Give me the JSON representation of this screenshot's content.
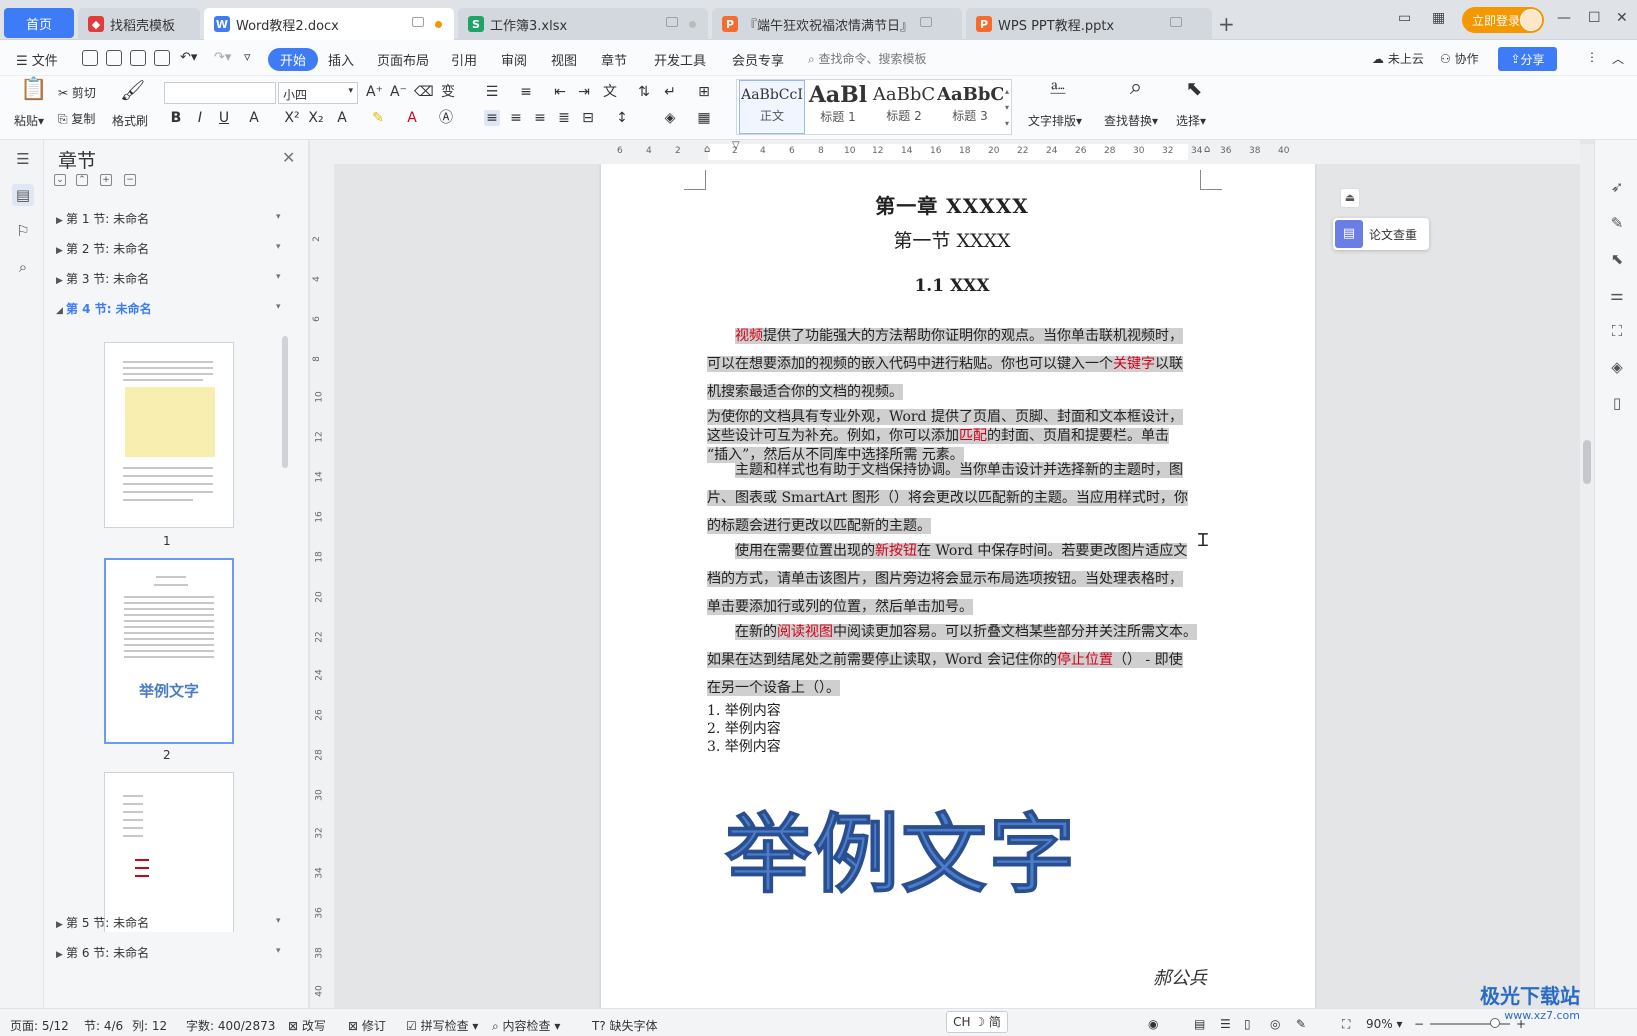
{
  "tabs": {
    "home": "首页",
    "items": [
      {
        "label": "找稻壳模板",
        "icon": "docer-icon",
        "color": "#e23b3b"
      },
      {
        "label": "Word教程2.docx",
        "icon": "word-icon",
        "color": "#3e7bf6"
      },
      {
        "label": "工作簿3.xlsx",
        "icon": "excel-icon",
        "color": "#21a366"
      },
      {
        "label": "『端午狂欢祝福浓情满节日』",
        "icon": "ppt-icon",
        "color": "#f56c2e"
      },
      {
        "label": "WPS PPT教程.pptx",
        "icon": "ppt-icon",
        "color": "#f56c2e"
      }
    ],
    "new_tab": "+",
    "login": "立即登录"
  },
  "menu": {
    "file": "文件",
    "items": [
      "开始",
      "插入",
      "页面布局",
      "引用",
      "审阅",
      "视图",
      "章节",
      "开发工具",
      "会员专享"
    ],
    "active": "开始",
    "search_placeholder": "查找命令、搜索模板",
    "cloud": "未上云",
    "collab": "协作",
    "share": "分享"
  },
  "ribbon": {
    "paste": "粘贴",
    "cut": "剪切",
    "copy": "复制",
    "format_painter": "格式刷",
    "font_size": "小四",
    "styles": [
      {
        "preview": "AaBbCcI",
        "label": "正文"
      },
      {
        "preview": "AaBl",
        "label": "标题 1"
      },
      {
        "preview": "AaBbC",
        "label": "标题 2"
      },
      {
        "preview": "AaBbC",
        "label": "标题 3"
      }
    ],
    "text_layout": "文字排版",
    "find_replace": "查找替换",
    "select": "选择"
  },
  "nav": {
    "title": "章节",
    "sections": [
      {
        "label": "第 1 节: 未命名"
      },
      {
        "label": "第 2 节: 未命名"
      },
      {
        "label": "第 3 节: 未命名"
      },
      {
        "label": "第 4 节: 未命名"
      }
    ],
    "sections_after": [
      {
        "label": "第 5 节: 未命名"
      },
      {
        "label": "第 6 节: 未命名"
      }
    ],
    "thumbs": [
      {
        "num": "1"
      },
      {
        "num": "2",
        "text": "举例文字"
      },
      {
        "num": ""
      }
    ]
  },
  "ruler": {
    "h": [
      "6",
      "4",
      "2",
      "2",
      "4",
      "6",
      "8",
      "10",
      "12",
      "14",
      "16",
      "18",
      "20",
      "22",
      "24",
      "26",
      "28",
      "30",
      "32",
      "34",
      "36",
      "38",
      "40"
    ],
    "v": [
      "2",
      "4",
      "6",
      "8",
      "10",
      "12",
      "14",
      "16",
      "18",
      "20",
      "22",
      "24",
      "26",
      "28",
      "30",
      "32",
      "34",
      "36",
      "38",
      "40"
    ]
  },
  "document": {
    "chapter": "第一章 XXXXX",
    "section": "第一节 XXXX",
    "subsection": "1.1 XXX",
    "p1": [
      [
        "",
        "视频",
        "提供了功能强大的方法帮助你证明你的观点。当你单击联机视频时，"
      ],
      [
        "可以在想要添加的视频的嵌入代码中进行粘贴。你也可以键入一个",
        "关键字",
        "以联"
      ],
      [
        "机搜索最适合你的文档的视频。",
        "",
        ""
      ]
    ],
    "p2": [
      [
        "为使你的文档具有专业外观，Word 提供了页眉、页脚、封面和文本框设计，",
        "",
        ""
      ],
      [
        "这些设计可互为补充。例如，你可以添加",
        "匹配",
        "的封面、页眉和提要栏。单击"
      ],
      [
        "“插入”，然后从不同库中选择所需 元素。",
        "",
        ""
      ]
    ],
    "p3": [
      "主题和样式也有助于文档保持协调。当你单击设计并选择新的主题时，图",
      "片、图表或 SmartArt 图形（）将会更改以匹配新的主题。当应用样式时，你",
      "的标题会进行更改以匹配新的主题。"
    ],
    "p4": [
      [
        "使用在需要位置出现的",
        "新按钮",
        "在 Word 中保存时间。若要更改图片适应文"
      ],
      [
        "档的方式，请单击该图片，图片旁边将会显示布局选项按钮。当处理表格时，",
        "",
        ""
      ],
      [
        "单击要添加行或列的位置，然后单击加号。",
        "",
        ""
      ]
    ],
    "p5": [
      [
        "在新的",
        "阅读视图",
        "中阅读更加容易。可以折叠文档某些部分并关注所需文本。"
      ],
      [
        "如果在达到结尾处之前需要停止读取，Word 会记住你的",
        "停止位置",
        "（） - 即使"
      ],
      [
        "在另一个设备上（）。",
        "",
        ""
      ]
    ],
    "list": [
      "1.  举例内容",
      "2.  举例内容",
      "3.  举例内容"
    ],
    "wordart": "举例文字",
    "signature": "郝公兵"
  },
  "float_button": "论文查重",
  "status": {
    "page": "页面: 5/12",
    "section": "节: 4/6",
    "column": "列: 12",
    "words": "字数: 400/2873",
    "overwrite": "改写",
    "revise": "修订",
    "spell": "拼写检查",
    "content": "内容检查",
    "missing_font": "缺失字体",
    "ime": "CH ☽ 简",
    "zoom": "90%"
  },
  "watermark": {
    "main": "极光下载站",
    "sub": "www.xz7.com"
  }
}
